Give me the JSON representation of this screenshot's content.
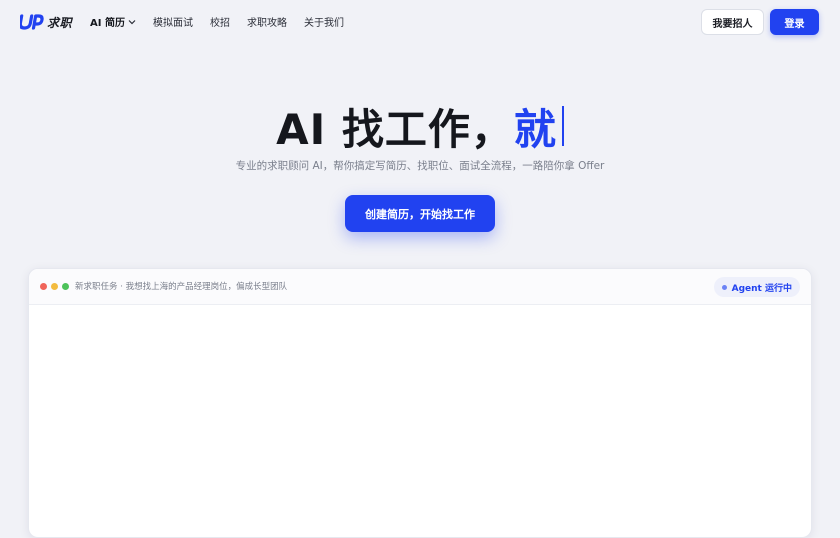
{
  "brand": {
    "mark": "UP",
    "name": "求职",
    "accent_color": "#2142f0"
  },
  "nav": {
    "items": [
      {
        "label": "AI 简历",
        "active": true,
        "has_dropdown": true
      },
      {
        "label": "模拟面试"
      },
      {
        "label": "校招"
      },
      {
        "label": "求职攻略"
      },
      {
        "label": "关于我们"
      }
    ],
    "recruit_label": "我要招人",
    "login_label": "登录"
  },
  "hero": {
    "title_main": "AI 找工作，",
    "title_accent": "就",
    "subtitle": "专业的求职顾问 AI，帮你搞定写简历、找职位、面试全流程，一路陪你拿 Offer",
    "cta_label": "创建简历，开始找工作"
  },
  "panel": {
    "dots": [
      "#f0645a",
      "#f3bb3f",
      "#4cc25a"
    ],
    "task_title": "新求职任务 · 我想找上海的产品经理岗位，偏成长型团队",
    "status_label": "Agent 运行中"
  }
}
